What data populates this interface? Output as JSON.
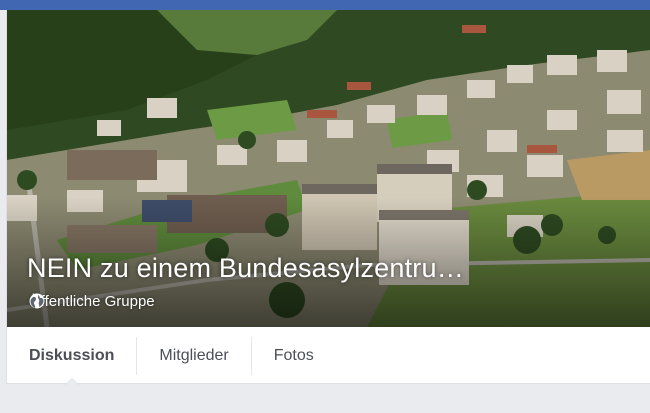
{
  "group": {
    "title": "NEIN zu einem Bundesasylzentru…",
    "privacy_label": "Öffentliche Gruppe",
    "privacy_icon": "globe-icon"
  },
  "tabs": [
    {
      "label": "Diskussion",
      "active": true
    },
    {
      "label": "Mitglieder",
      "active": false
    },
    {
      "label": "Fotos",
      "active": false
    }
  ],
  "colors": {
    "topbar": "#4267b2",
    "background": "#e9ebee",
    "tab_text": "#4b4f56"
  }
}
